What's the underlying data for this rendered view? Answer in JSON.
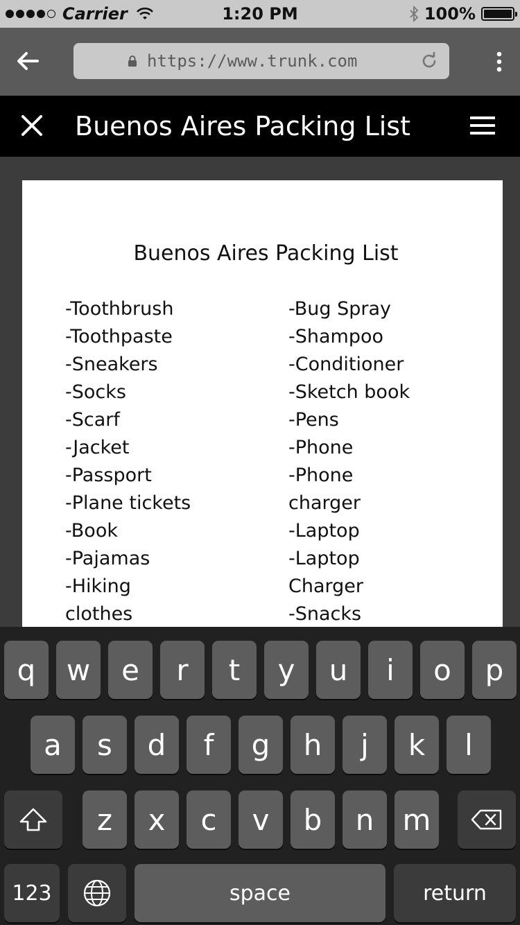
{
  "status_bar": {
    "carrier": "Carrier",
    "time": "1:20 PM",
    "battery": "100%"
  },
  "browser": {
    "url": "https://www.trunk.com"
  },
  "app_bar": {
    "title": "Buenos Aires Packing List"
  },
  "document": {
    "title": "Buenos Aires Packing List",
    "left_column": [
      "-Toothbrush",
      "-Toothpaste",
      "-Sneakers",
      "-Socks",
      "-Scarf",
      "-Jacket",
      "-Passport",
      "-Plane tickets",
      "-Book",
      "-Pajamas",
      "-Hiking",
      "clothes"
    ],
    "right_column": [
      "-Bug Spray",
      "-Shampoo",
      "-Conditioner",
      "-Sketch book",
      "-Pens",
      "-Phone",
      "-Phone",
      "charger",
      "-Laptop",
      "-Laptop",
      "Charger",
      "-Snacks"
    ]
  },
  "keyboard": {
    "row1": [
      "q",
      "w",
      "e",
      "r",
      "t",
      "y",
      "u",
      "i",
      "o",
      "p"
    ],
    "row2": [
      "a",
      "s",
      "d",
      "f",
      "g",
      "h",
      "j",
      "k",
      "l"
    ],
    "row3": [
      "z",
      "x",
      "c",
      "v",
      "b",
      "n",
      "m"
    ],
    "numbers_label": "123",
    "space_label": "space",
    "return_label": "return"
  }
}
